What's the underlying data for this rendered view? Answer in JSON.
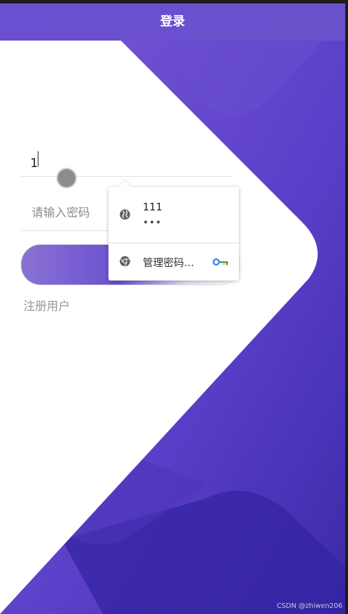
{
  "header": {
    "title": "登录"
  },
  "form": {
    "username_value": "1",
    "password_placeholder": "请输入密码",
    "register_label": "注册用户"
  },
  "password_popup": {
    "saved_username": "111",
    "saved_password_mask": "•••",
    "manage_label": "管理密码…",
    "icons": [
      "globe-icon",
      "chrome-icon",
      "key-icon"
    ]
  },
  "watermark": "CSDN @zhiwen206",
  "colors": {
    "header": "#6a4fd0",
    "background_purple": "#5a3fc4",
    "dark_purple": "#3424a0",
    "white": "#ffffff"
  }
}
